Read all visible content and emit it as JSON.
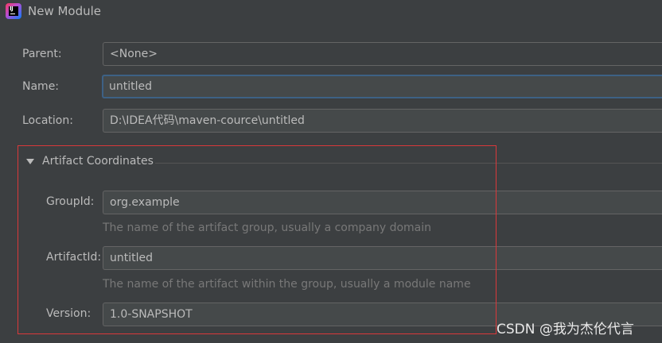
{
  "window": {
    "title": "New Module"
  },
  "form": {
    "parent": {
      "label": "Parent:",
      "value": "<None>"
    },
    "name": {
      "label": "Name:",
      "value": "untitled"
    },
    "location": {
      "label": "Location:",
      "value": "D:\\IDEA代码\\maven-cource\\untitled"
    }
  },
  "artifact": {
    "section_title": "Artifact Coordinates",
    "group_id": {
      "label": "GroupId:",
      "value": "org.example",
      "hint": "The name of the artifact group, usually a company domain"
    },
    "artifact_id": {
      "label": "ArtifactId:",
      "value": "untitled",
      "hint": "The name of the artifact within the group, usually a module name"
    },
    "version": {
      "label": "Version:",
      "value": "1.0-SNAPSHOT"
    }
  },
  "watermark": {
    "text": "CSDN @我为杰伦代言"
  },
  "colors": {
    "background": "#3c3f41",
    "field_background": "#45494a",
    "focus_border": "#3d6185",
    "highlight_border": "#d9383a",
    "hint_text": "#787878"
  },
  "icons": {
    "app": "intellij-idea-icon",
    "section_toggle": "triangle-down-icon"
  }
}
